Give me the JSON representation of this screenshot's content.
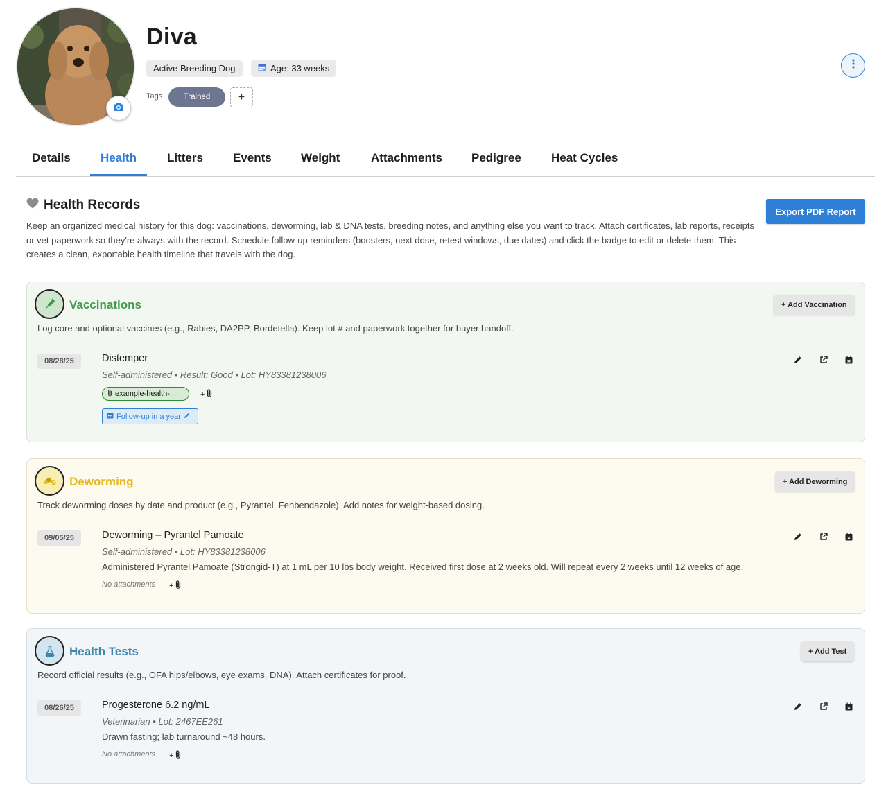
{
  "dog": {
    "name": "Diva",
    "status": "Active Breeding Dog",
    "age": "Age: 33 weeks",
    "tags_label": "Tags",
    "tags": [
      "Trained"
    ],
    "add_tag": "+"
  },
  "tabs": [
    "Details",
    "Health",
    "Litters",
    "Events",
    "Weight",
    "Attachments",
    "Pedigree",
    "Heat Cycles"
  ],
  "active_tab": "Health",
  "health": {
    "title": "Health Records",
    "description": "Keep an organized medical history for this dog: vaccinations, deworming, lab & DNA tests, breeding notes, and anything else you want to track. Attach certificates, lab reports, receipts or vet paperwork so they're always with the record. Schedule follow-up reminders (boosters, next dose, retest windows, due dates) and click the badge to edit or delete them. This creates a clean, exportable health timeline that travels with the dog.",
    "export_label": "Export PDF Report"
  },
  "sections": {
    "vaccinations": {
      "title": "Vaccinations",
      "description": "Log core and optional vaccines (e.g., Rabies, DA2PP, Bordetella). Keep lot # and paperwork together for buyer handoff.",
      "add_label": "+ Add Vaccination",
      "title_color": "#3f9a4a",
      "record": {
        "date": "08/28/25",
        "title": "Distemper",
        "meta": "Self-administered • Result: Good • Lot: HY83381238006",
        "attachment": "example-health-...",
        "add_attachment": "+",
        "followup": "Follow-up in a year"
      }
    },
    "deworming": {
      "title": "Deworming",
      "description": "Track deworming doses by date and product (e.g., Pyrantel, Fenbendazole). Add notes for weight-based dosing.",
      "add_label": "+ Add Deworming",
      "title_color": "#e3b923",
      "record": {
        "date": "09/05/25",
        "title": "Deworming – Pyrantel Pamoate",
        "meta": "Self-administered • Lot: HY83381238006",
        "note": "Administered Pyrantel Pamoate (Strongid-T) at 1 mL per 10 lbs body weight. Received first dose at 2 weeks old. Will repeat every 2 weeks until 12 weeks of age.",
        "no_attachments": "No attachments",
        "add_attachment": "+"
      }
    },
    "tests": {
      "title": "Health Tests",
      "description": "Record official results (e.g., OFA hips/elbows, eye exams, DNA). Attach certificates for proof.",
      "add_label": "+ Add Test",
      "title_color": "#3f87a8",
      "record": {
        "date": "08/26/25",
        "title": "Progesterone 6.2 ng/mL",
        "meta": "Veterinarian • Lot: 2467EE261",
        "note": "Drawn fasting; lab turnaround ~48 hours.",
        "no_attachments": "No attachments",
        "add_attachment": "+"
      }
    }
  },
  "icons": {
    "camera": "camera-icon",
    "calendar": "calendar-icon",
    "more": "more-vertical-icon",
    "heart": "heart-icon",
    "syringe": "syringe-icon",
    "pills": "pills-icon",
    "flask": "flask-icon",
    "edit": "pencil-icon",
    "open": "external-link-icon",
    "delete": "calendar-delete-icon",
    "paperclip": "paperclip-icon"
  },
  "colors": {
    "accent": "#2e7fd6",
    "tag": "#6d7590"
  }
}
